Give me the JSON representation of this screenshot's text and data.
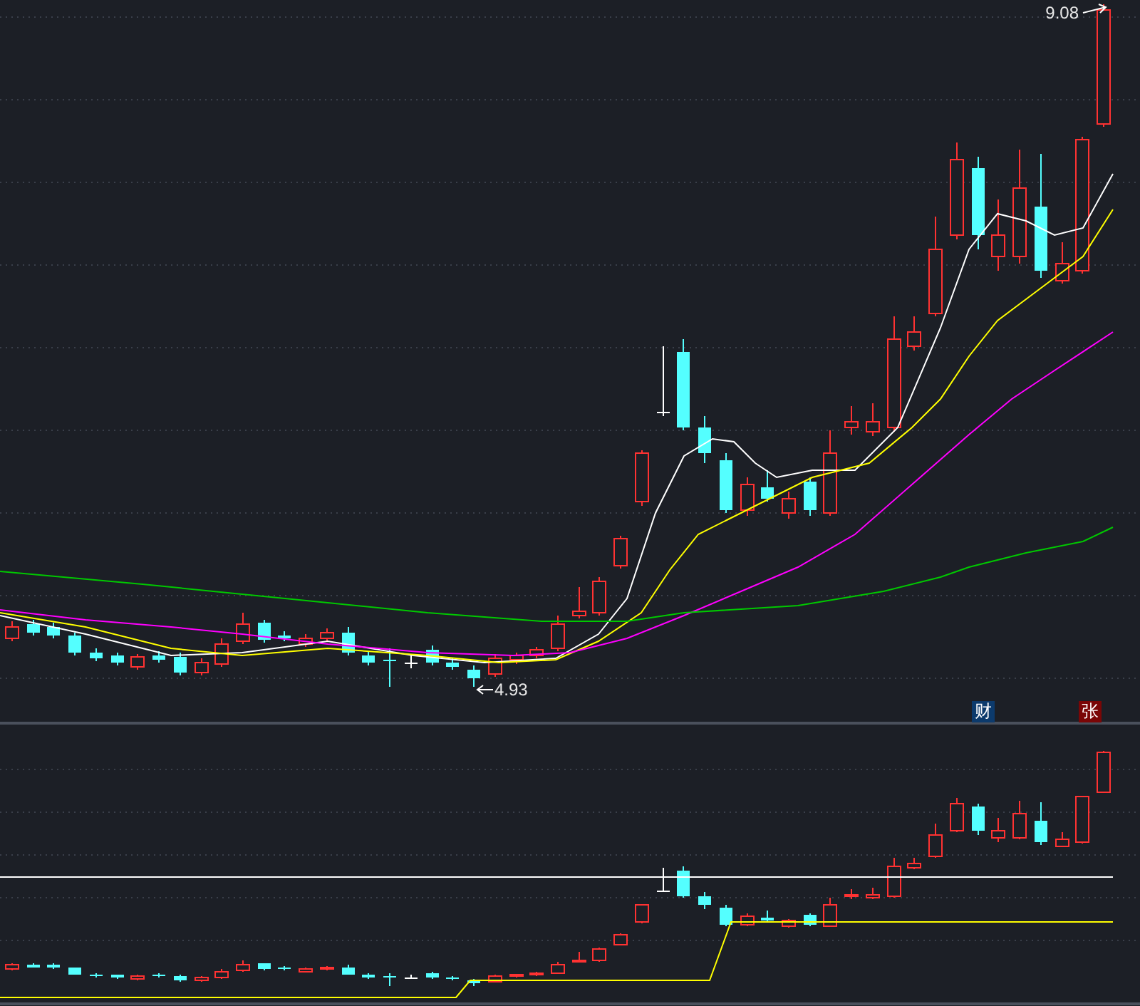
{
  "chart": {
    "high_label": "9.08",
    "low_label": "4.93"
  },
  "markers": [
    {
      "text": "财",
      "kind": "finance"
    },
    {
      "text": "张",
      "kind": "rise"
    }
  ]
}
